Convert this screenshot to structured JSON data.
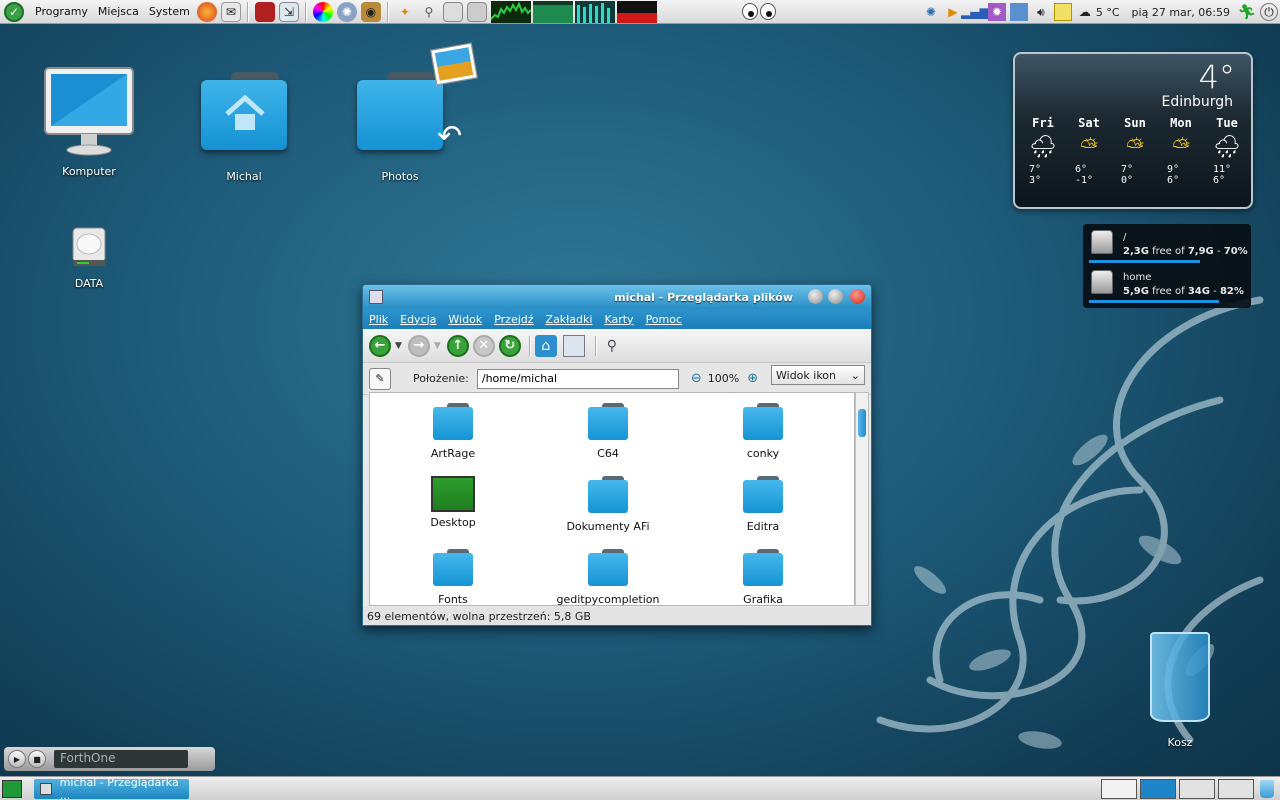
{
  "top_panel": {
    "menus": [
      "Programy",
      "Miejsca",
      "System"
    ],
    "weather_temp": "5 °C",
    "datetime": "pią 27 mar, 06:59"
  },
  "desktop": {
    "icons": [
      {
        "label": "Komputer"
      },
      {
        "label": "Michal"
      },
      {
        "label": "Photos"
      },
      {
        "label": "DATA"
      }
    ],
    "trash_label": "Kosz"
  },
  "weather": {
    "temperature": "4°",
    "city": "Edinburgh",
    "days": [
      {
        "name": "Fri",
        "icon": "rain-icon",
        "hi": "7°",
        "lo": "3°"
      },
      {
        "name": "Sat",
        "icon": "partly-sunny-icon",
        "hi": "6°",
        "lo": "-1°"
      },
      {
        "name": "Sun",
        "icon": "partly-sunny-icon",
        "hi": "7°",
        "lo": "0°"
      },
      {
        "name": "Mon",
        "icon": "partly-sunny-icon",
        "hi": "9°",
        "lo": "6°"
      },
      {
        "name": "Tue",
        "icon": "rain-icon",
        "hi": "11°",
        "lo": "6°"
      }
    ]
  },
  "disks": [
    {
      "name": "/",
      "free": "2,3G",
      "total": "7,9G",
      "percent": "70%",
      "fill": 0.7
    },
    {
      "name": "home",
      "free": "5,9G",
      "total": "34G",
      "percent": "82%",
      "fill": 0.82
    }
  ],
  "file_manager": {
    "title": "michal - Przeglądarka plików",
    "menu": [
      "Plik",
      "Edycja",
      "Widok",
      "Przejdź",
      "Zakładki",
      "Karty",
      "Pomoc"
    ],
    "location_label": "Położenie:",
    "location_value": "/home/michal",
    "zoom": "100%",
    "view_mode": "Widok ikon",
    "items": [
      {
        "label": "ArtRage",
        "type": "folder"
      },
      {
        "label": "C64",
        "type": "folder"
      },
      {
        "label": "conky",
        "type": "folder"
      },
      {
        "label": "Desktop",
        "type": "desktop"
      },
      {
        "label": "Dokumenty AFi",
        "type": "folder"
      },
      {
        "label": "Editra",
        "type": "folder"
      },
      {
        "label": "Fonts",
        "type": "folder"
      },
      {
        "label": "geditpycompletion",
        "type": "folder"
      },
      {
        "label": "Grafika",
        "type": "folder"
      }
    ],
    "status": "69 elementów, wolna przestrzeń: 5,8 GB"
  },
  "player": {
    "station": "ForthOne"
  },
  "taskbar": {
    "tasks": [
      {
        "label": "michal - Przeglądarka ..."
      }
    ]
  }
}
